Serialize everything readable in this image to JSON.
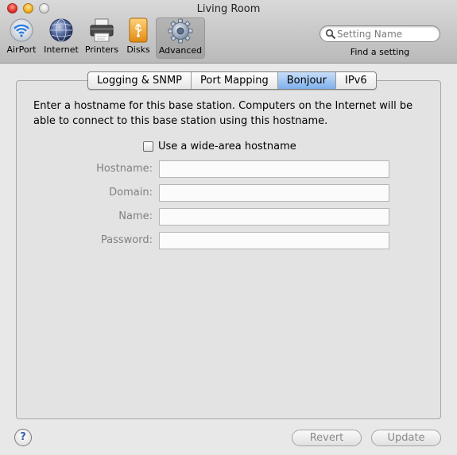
{
  "window": {
    "title": "Living Room"
  },
  "toolbar": {
    "items": [
      {
        "label": "AirPort",
        "icon": "airport-icon"
      },
      {
        "label": "Internet",
        "icon": "globe-icon"
      },
      {
        "label": "Printers",
        "icon": "printer-icon"
      },
      {
        "label": "Disks",
        "icon": "disk-icon"
      },
      {
        "label": "Advanced",
        "icon": "gear-icon",
        "selected": true
      }
    ],
    "search": {
      "placeholder": "Setting Name",
      "caption": "Find a setting"
    }
  },
  "tabs": [
    {
      "label": "Logging & SNMP"
    },
    {
      "label": "Port Mapping"
    },
    {
      "label": "Bonjour",
      "active": true
    },
    {
      "label": "IPv6"
    }
  ],
  "bonjour": {
    "description": "Enter a hostname for this base station. Computers on the Internet will be able to connect to this base station using this hostname.",
    "checkbox_label": "Use a wide-area hostname",
    "checkbox_checked": false,
    "fields": {
      "hostname": {
        "label": "Hostname:",
        "value": ""
      },
      "domain": {
        "label": "Domain:",
        "value": ""
      },
      "name": {
        "label": "Name:",
        "value": ""
      },
      "password": {
        "label": "Password:",
        "value": ""
      }
    }
  },
  "footer": {
    "help_label": "?",
    "revert_label": "Revert",
    "update_label": "Update"
  }
}
